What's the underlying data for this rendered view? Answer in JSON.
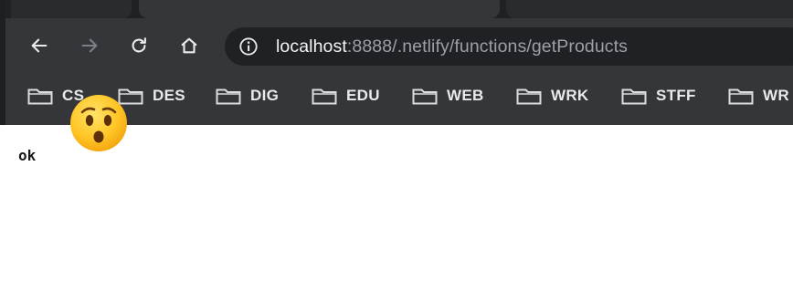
{
  "browser": {
    "omnibox": {
      "url_host": "localhost",
      "url_rest": ":8888/.netlify/functions/getProducts"
    },
    "nav": {
      "back_icon": "arrow-left-icon",
      "forward_icon": "arrow-right-icon",
      "reload_icon": "reload-icon",
      "home_icon": "home-icon",
      "site_info_icon": "info-icon"
    },
    "bookmarks": [
      {
        "label": "CS"
      },
      {
        "label": "DES"
      },
      {
        "label": "DIG"
      },
      {
        "label": "EDU"
      },
      {
        "label": "WEB"
      },
      {
        "label": "WRK"
      },
      {
        "label": "STFF"
      },
      {
        "label": "WR"
      }
    ]
  },
  "page": {
    "body_text": "ok"
  },
  "overlay": {
    "emoji_icon": "astonished-face-emoji"
  },
  "colors": {
    "toolbar_bg": "#35363a",
    "omnibox_bg": "#202124",
    "url_host": "#f1f3f4",
    "url_rest": "#9aa0a6",
    "page_bg": "#ffffff"
  }
}
